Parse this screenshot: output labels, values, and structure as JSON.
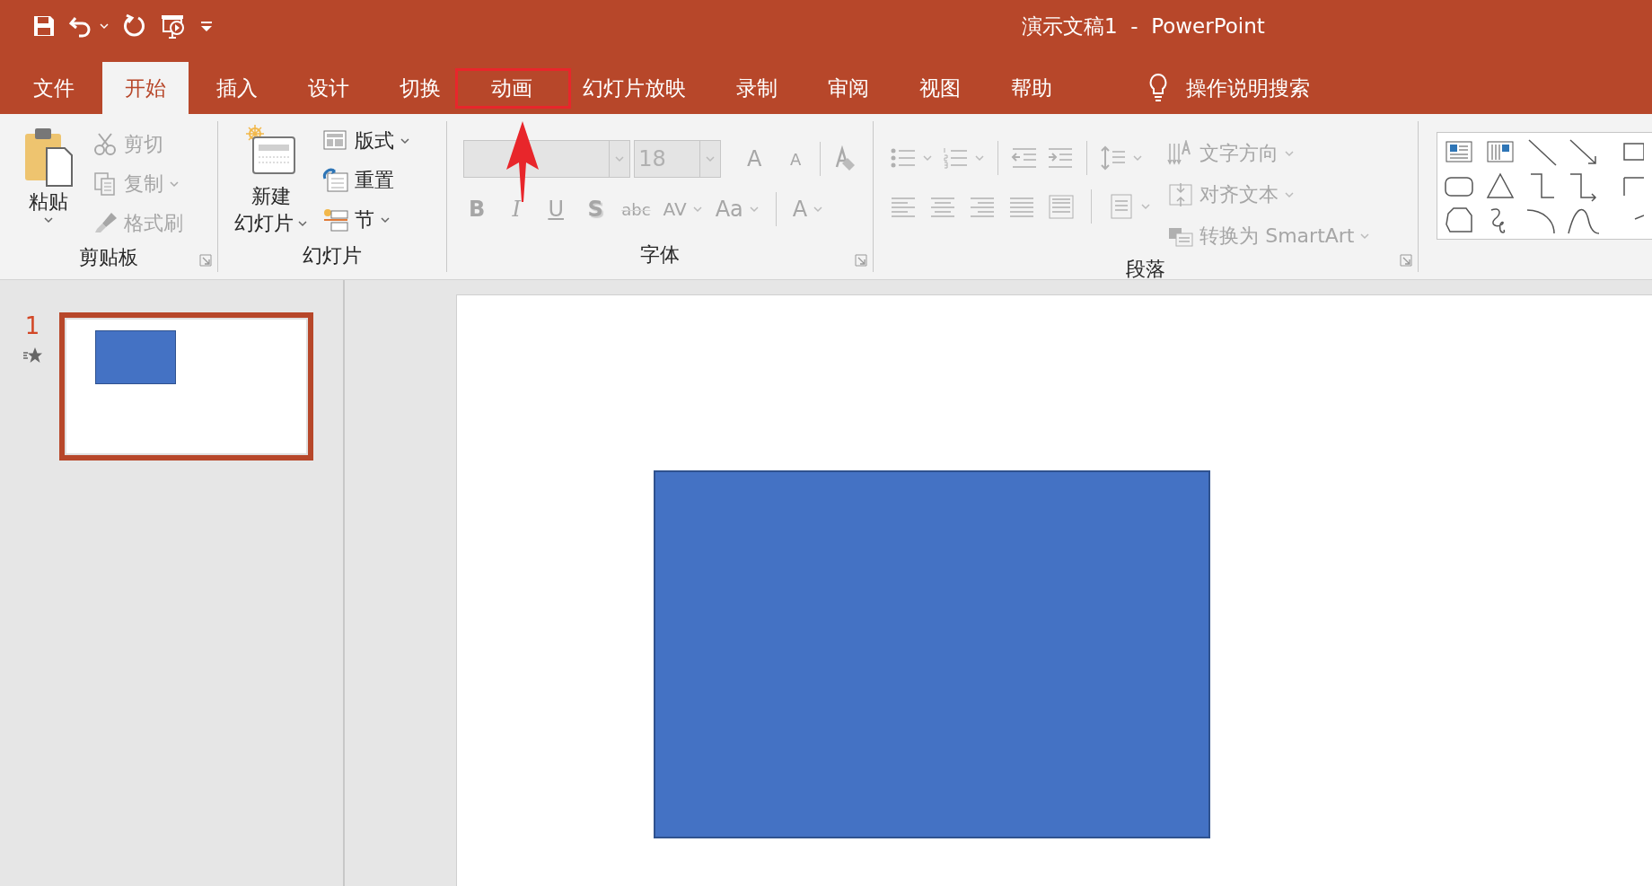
{
  "window": {
    "title": "演示文稿1  -  PowerPoint"
  },
  "tabs": [
    {
      "label": "文件",
      "selected": false,
      "highlighted": false
    },
    {
      "label": "开始",
      "selected": true,
      "highlighted": false
    },
    {
      "label": "插入",
      "selected": false,
      "highlighted": false
    },
    {
      "label": "设计",
      "selected": false,
      "highlighted": false
    },
    {
      "label": "切换",
      "selected": false,
      "highlighted": false
    },
    {
      "label": "动画",
      "selected": false,
      "highlighted": true
    },
    {
      "label": "幻灯片放映",
      "selected": false,
      "highlighted": false
    },
    {
      "label": "录制",
      "selected": false,
      "highlighted": false
    },
    {
      "label": "审阅",
      "selected": false,
      "highlighted": false
    },
    {
      "label": "视图",
      "selected": false,
      "highlighted": false
    },
    {
      "label": "帮助",
      "selected": false,
      "highlighted": false
    }
  ],
  "tell_me": {
    "label": "操作说明搜索"
  },
  "ribbon": {
    "groups": [
      {
        "kind": "clipboard",
        "label": "剪贴板",
        "launcher": true,
        "items": [
          {
            "label": "粘贴",
            "disabled": false,
            "dropdown": true
          },
          {
            "label": "剪切",
            "disabled": true,
            "dropdown": false
          },
          {
            "label": "复制",
            "disabled": true,
            "dropdown": true
          },
          {
            "label": "格式刷",
            "disabled": true,
            "dropdown": false
          }
        ]
      },
      {
        "kind": "slides",
        "label": "幻灯片",
        "launcher": false,
        "items": [
          {
            "label_lines": [
              "新建",
              "幻灯片"
            ],
            "dropdown": true
          },
          {
            "label": "版式",
            "dropdown": true
          },
          {
            "label": "重置",
            "dropdown": false
          },
          {
            "label": "节",
            "dropdown": true
          }
        ]
      },
      {
        "kind": "font",
        "label": "字体",
        "launcher": true,
        "disabled": true,
        "font_size": {
          "value": "18"
        },
        "size_buttons": [
          {
            "label": "A",
            "kind": "grow"
          },
          {
            "label": "A",
            "kind": "shrink"
          }
        ],
        "format_buttons": [
          {
            "label": "B",
            "kind": "bold",
            "dropdown": false
          },
          {
            "label": "I",
            "kind": "italic",
            "dropdown": false
          },
          {
            "label": "U",
            "kind": "underline",
            "dropdown": false
          },
          {
            "label": "S",
            "kind": "shadow",
            "dropdown": false
          },
          {
            "label": "abc",
            "kind": "strike",
            "dropdown": false
          },
          {
            "label": "AV",
            "kind": "spacing",
            "dropdown": true
          },
          {
            "label": "Aa",
            "kind": "case",
            "dropdown": true
          },
          {
            "label": "A",
            "kind": "color",
            "dropdown": true
          }
        ]
      },
      {
        "kind": "paragraph",
        "label": "段落",
        "launcher": true,
        "disabled": true,
        "text_items": [
          {
            "label": "文字方向",
            "dropdown": true
          },
          {
            "label": "对齐文本",
            "dropdown": true
          },
          {
            "label": "转换为 SmartArt",
            "dropdown": true
          }
        ]
      },
      {
        "kind": "shapes"
      }
    ]
  },
  "slides_pane": {
    "thumbnails": [
      {
        "number": "1",
        "selected": true,
        "animated": true
      }
    ]
  }
}
